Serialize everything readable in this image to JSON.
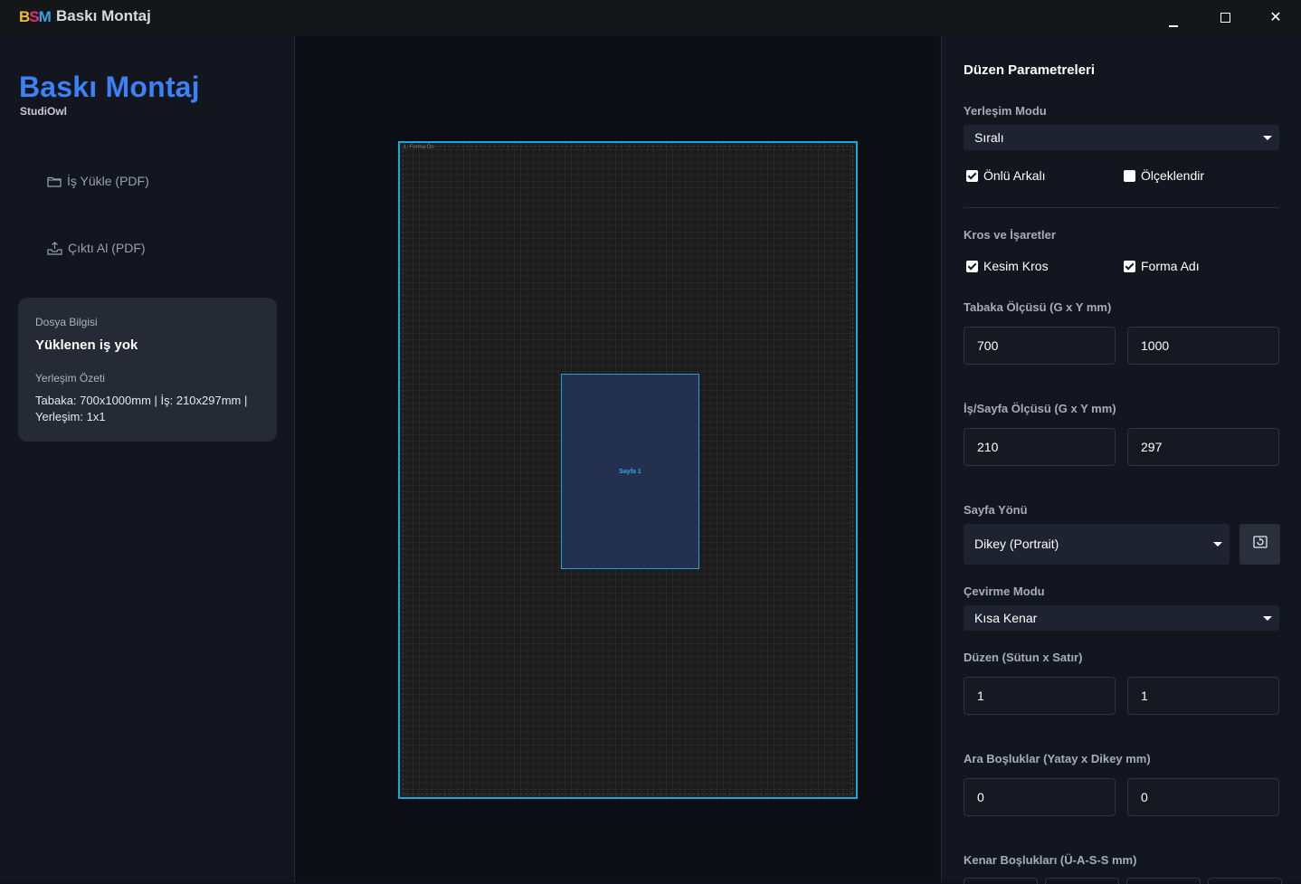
{
  "window": {
    "title": "Baskı Montaj",
    "logo": "app-logo",
    "controls": [
      "minimize",
      "maximize",
      "close"
    ],
    "close_glyph": "✕"
  },
  "sidebar": {
    "brand_title": "Baskı Montaj",
    "brand_subtitle": "StudiOwl",
    "upload_label": "İş Yükle (PDF)",
    "export_label": "Çıktı Al (PDF)",
    "upload_icon": "folder-icon",
    "export_icon": "tray-upload-icon",
    "info_card": {
      "file_label": "Dosya Bilgisi",
      "file_value": "Yüklenen iş yok",
      "summary_label": "Yerleşim Özeti",
      "summary_value": "Tabaka: 700x1000mm | İş: 210x297mm | Yerleşim: 1x1"
    }
  },
  "preview": {
    "forma_label": "1. Forma Ön",
    "page_label": "Sayfa 1",
    "colors": {
      "sheet_border": "#1ba5d8",
      "page_fill": "#243050",
      "accent": "#3b82f6"
    }
  },
  "panel": {
    "heading": "Düzen Parametreleri",
    "placement_mode_label": "Yerleşim Modu",
    "placement_mode_value": "Sıralı",
    "duplex_label": "Önlü Arkalı",
    "duplex_checked": true,
    "scaled_label": "Ölçeklendir",
    "scaled_checked": false,
    "marks_label": "Kros ve İşaretler",
    "crop_marks_label": "Kesim Kros",
    "crop_marks_checked": true,
    "forma_name_label": "Forma Adı",
    "forma_name_checked": true,
    "sheet_size_label": "Tabaka Ölçüsü (G x Y mm)",
    "sheet_width": "700",
    "sheet_height": "1000",
    "page_size_label": "İş/Sayfa Ölçüsü (G x Y mm)",
    "page_width": "210",
    "page_height": "297",
    "orientation_label": "Sayfa Yönü",
    "orientation_value": "Dikey (Portrait)",
    "rotate_icon": "rotate-icon",
    "flip_mode_label": "Çevirme Modu",
    "flip_mode_value": "Kısa Kenar",
    "layout_label": "Düzen (Sütun x Satır)",
    "layout_cols": "1",
    "layout_rows": "1",
    "gaps_label": "Ara Boşluklar (Yatay x Dikey mm)",
    "gap_h": "0",
    "gap_v": "0",
    "margins_label": "Kenar Boşlukları (Ü-A-S-S mm)"
  }
}
